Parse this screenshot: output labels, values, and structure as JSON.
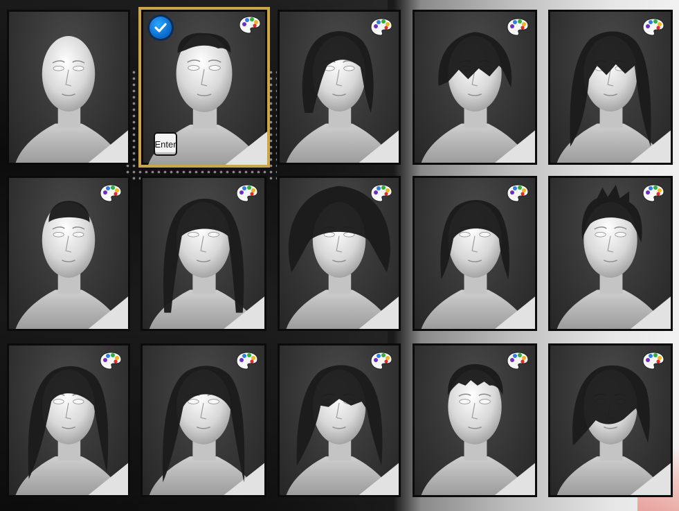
{
  "screen": {
    "selected_index": 1,
    "enter_key_label": "Enter",
    "accent_colors": {
      "selection_border": "#c9a64a",
      "check_badge": "#1e8fe8"
    }
  },
  "hairstyles": [
    {
      "style": "bald",
      "has_color_palette": false
    },
    {
      "style": "short-undercut",
      "has_color_palette": true
    },
    {
      "style": "long-wavy",
      "has_color_palette": true
    },
    {
      "style": "bowl-fringe",
      "has_color_palette": true
    },
    {
      "style": "long-straight-bangs",
      "has_color_palette": true
    },
    {
      "style": "buzz-cut",
      "has_color_palette": true
    },
    {
      "style": "long-dreadlocks",
      "has_color_palette": true
    },
    {
      "style": "afro",
      "has_color_palette": true
    },
    {
      "style": "mullet",
      "has_color_palette": true
    },
    {
      "style": "spiky",
      "has_color_palette": true
    },
    {
      "style": "long-side-part",
      "has_color_palette": true
    },
    {
      "style": "long-slicked-back",
      "has_color_palette": true
    },
    {
      "style": "long-layered",
      "has_color_palette": true
    },
    {
      "style": "short-textured",
      "has_color_palette": true
    },
    {
      "style": "emo-fringe",
      "has_color_palette": true
    }
  ],
  "icons": {
    "palette": "color-palette-icon",
    "check": "checkmark-icon"
  }
}
